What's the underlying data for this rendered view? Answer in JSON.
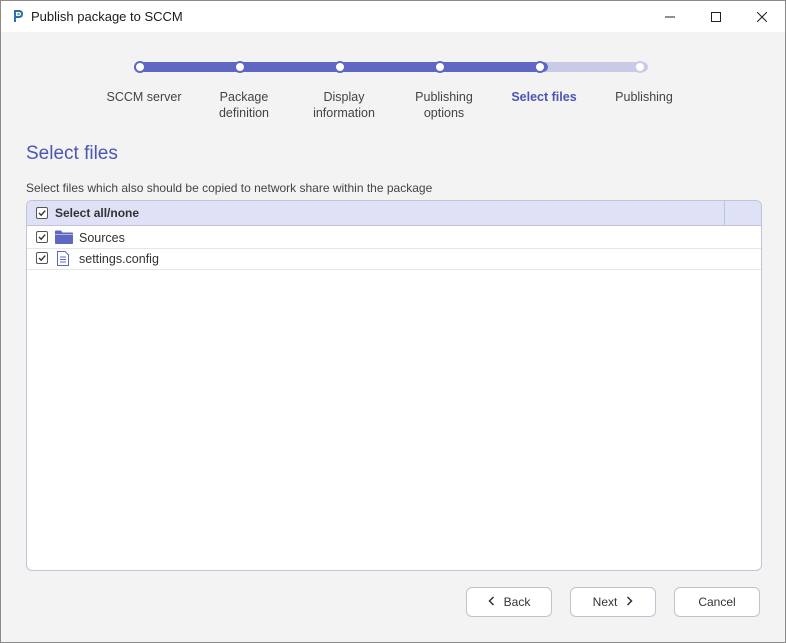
{
  "window": {
    "title": "Publish package to SCCM"
  },
  "steps": [
    {
      "label": "SCCM server",
      "state": "done"
    },
    {
      "label": "Package definition",
      "state": "done"
    },
    {
      "label": "Display information",
      "state": "done"
    },
    {
      "label": "Publishing options",
      "state": "done"
    },
    {
      "label": "Select files",
      "state": "active"
    },
    {
      "label": "Publishing",
      "state": "pending"
    }
  ],
  "section": {
    "title": "Select files",
    "description": "Select files which also should be copied to network share within the package"
  },
  "file_list": {
    "header": {
      "label": "Select all/none",
      "checked": true
    },
    "items": [
      {
        "name": "Sources",
        "type": "folder",
        "checked": true,
        "icon": "folder-icon"
      },
      {
        "name": "settings.config",
        "type": "file",
        "checked": true,
        "icon": "file-icon"
      }
    ]
  },
  "buttons": {
    "back": "Back",
    "next": "Next",
    "cancel": "Cancel"
  },
  "colors": {
    "accent": "#5f67c2",
    "accent_text": "#4c55b3",
    "track_pending": "#c9cbe6",
    "header_bg": "#dfe1f6"
  }
}
